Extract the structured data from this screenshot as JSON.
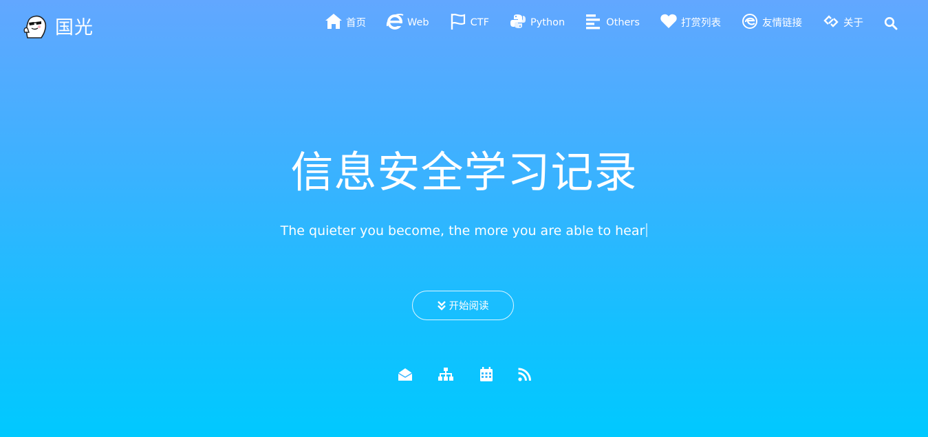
{
  "brand": {
    "name": "国光",
    "logo_icon": "mascot-sunglasses-icon"
  },
  "nav": {
    "items": [
      {
        "label": "首页",
        "icon": "home-icon"
      },
      {
        "label": "Web",
        "icon": "internet-explorer-icon"
      },
      {
        "label": "CTF",
        "icon": "flag-icon"
      },
      {
        "label": "Python",
        "icon": "python-icon"
      },
      {
        "label": "Others",
        "icon": "align-left-icon"
      },
      {
        "label": "打赏列表",
        "icon": "heart-icon"
      },
      {
        "label": "友情链接",
        "icon": "edge-icon"
      },
      {
        "label": "关于",
        "icon": "link-icon"
      }
    ],
    "search_icon": "search-icon"
  },
  "hero": {
    "title": "信息安全学习记录",
    "subtitle": "The quieter you become, the more you are able to hear",
    "read_button": {
      "label": "开始阅读",
      "icon": "angle-double-down-icon"
    }
  },
  "social": [
    {
      "icon": "envelope-open-icon"
    },
    {
      "icon": "sitemap-icon"
    },
    {
      "icon": "calendar-icon"
    },
    {
      "icon": "rss-icon"
    }
  ],
  "colors": {
    "gradient_top": "#62a7ff",
    "gradient_bottom": "#00c9ff",
    "text": "#ffffff"
  }
}
